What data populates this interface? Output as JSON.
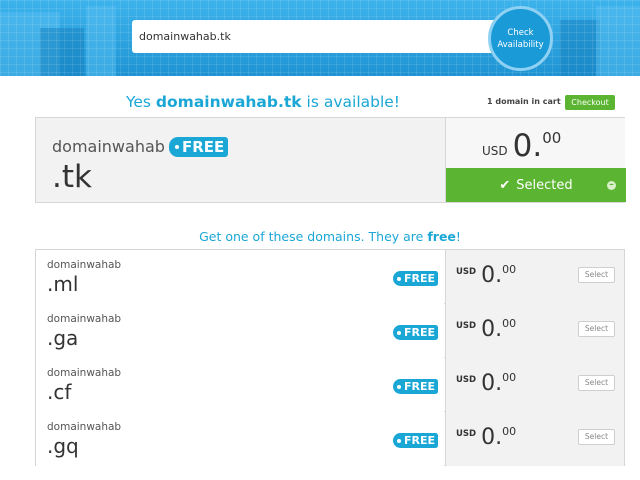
{
  "search": {
    "value": "domainwahab.tk",
    "check_button": [
      "Check",
      "Availability"
    ]
  },
  "availability": {
    "prefix": "Yes ",
    "domain": "domainwahab.tk",
    "suffix": " is available!"
  },
  "cart": {
    "count_text": "1 domain in cart",
    "checkout_label": "Checkout"
  },
  "selected_domain": {
    "name": "domainwahab",
    "tld": ".tk",
    "badge": "FREE",
    "currency": "USD",
    "price_int": "0.",
    "price_dec": "00",
    "button_label": "Selected",
    "check_icon": "check-icon",
    "minus_icon": "minus-circle-icon",
    "button_color": "#5bb532"
  },
  "suggestions": {
    "title_prefix": "Get one of these domains. They are ",
    "title_bold": "free",
    "title_suffix": "!",
    "items": [
      {
        "name": "domainwahab",
        "tld": ".ml",
        "badge": "FREE",
        "currency": "USD",
        "price_int": "0.",
        "price_dec": "00",
        "button": "Select"
      },
      {
        "name": "domainwahab",
        "tld": ".ga",
        "badge": "FREE",
        "currency": "USD",
        "price_int": "0.",
        "price_dec": "00",
        "button": "Select"
      },
      {
        "name": "domainwahab",
        "tld": ".cf",
        "badge": "FREE",
        "currency": "USD",
        "price_int": "0.",
        "price_dec": "00",
        "button": "Select"
      },
      {
        "name": "domainwahab",
        "tld": ".gq",
        "badge": "FREE",
        "currency": "USD",
        "price_int": "0.",
        "price_dec": "00",
        "button": "Select"
      }
    ]
  },
  "colors": {
    "accent": "#1ba7d6",
    "green": "#5bb532",
    "header": "#2aa3e0"
  }
}
